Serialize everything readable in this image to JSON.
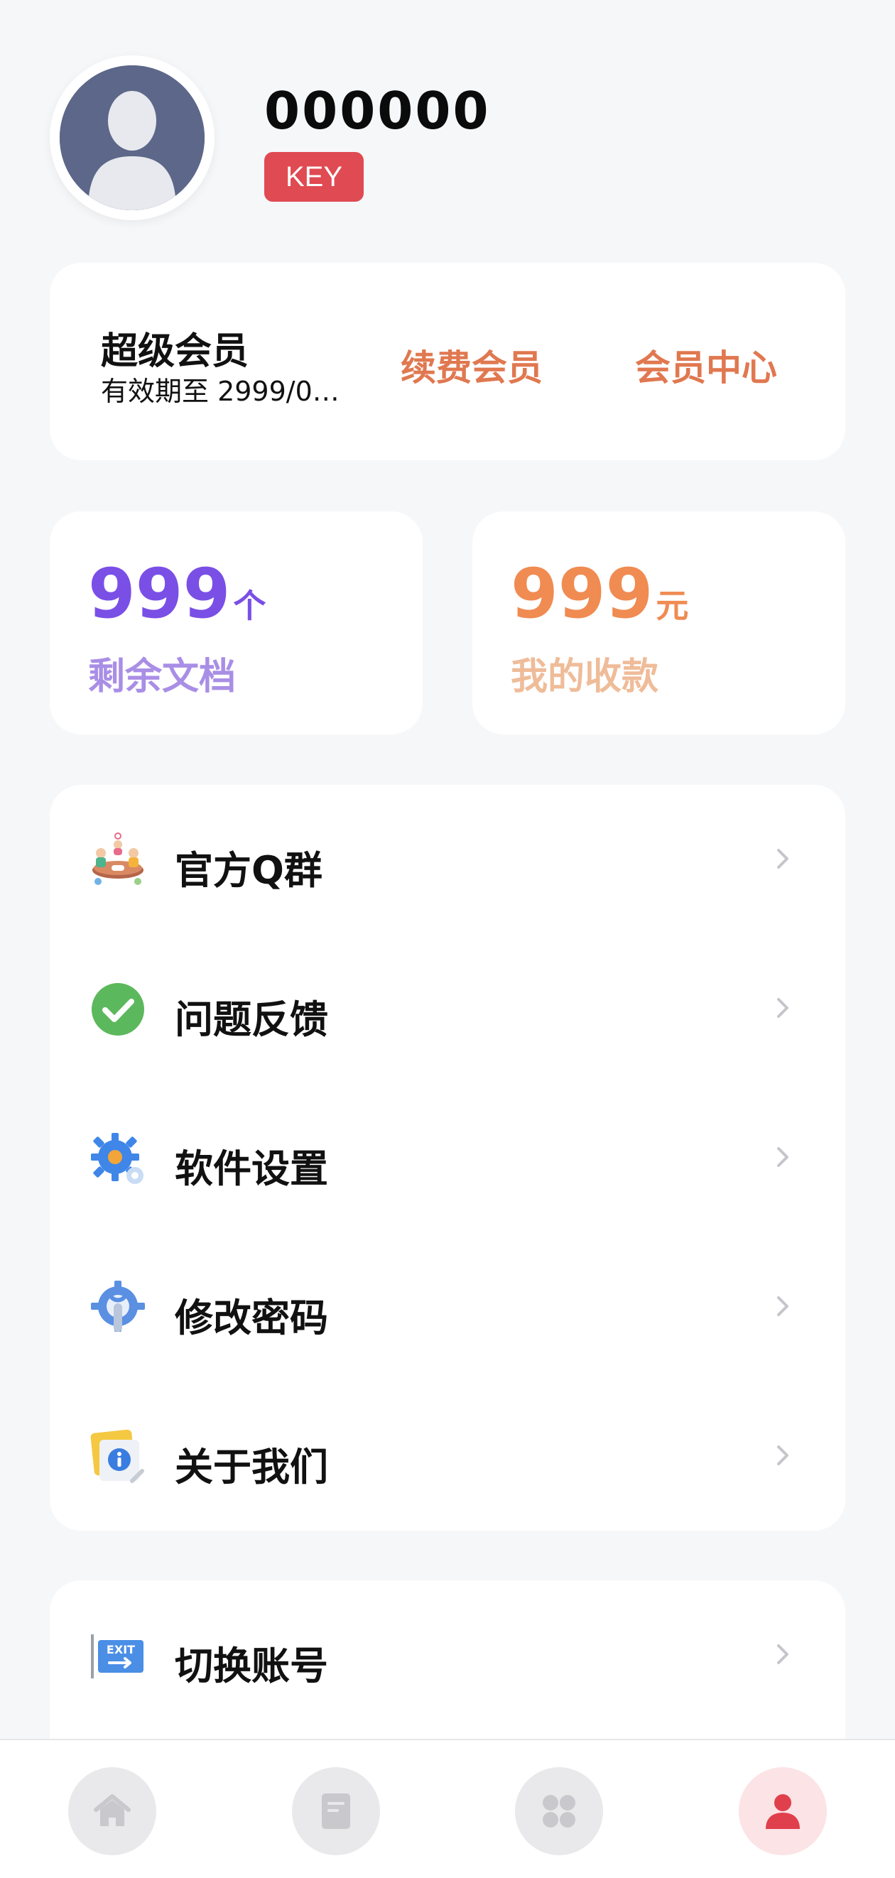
{
  "profile": {
    "username": "000000",
    "badge": "KEY",
    "avatar_icon": "user-silhouette-icon"
  },
  "vip": {
    "title": "超级会员",
    "expiry": "有效期至  2999/0…",
    "renew_label": "续费会员",
    "center_label": "会员中心"
  },
  "stats": {
    "docs": {
      "value": "999",
      "unit": "个",
      "label": "剩余文档"
    },
    "payments": {
      "value": "999",
      "unit": "元",
      "label": "我的收款"
    }
  },
  "menu": {
    "items": [
      {
        "label": "官方Q群",
        "icon": "group-chat-icon"
      },
      {
        "label": "问题反馈",
        "icon": "check-circle-icon"
      },
      {
        "label": "软件设置",
        "icon": "gear-icon"
      },
      {
        "label": "修改密码",
        "icon": "wrench-gear-icon"
      },
      {
        "label": "关于我们",
        "icon": "info-icon"
      }
    ],
    "switch_account": {
      "label": "切换账号",
      "icon": "exit-icon"
    }
  },
  "bottom_nav": {
    "items": [
      "home-icon",
      "document-icon",
      "apps-icon",
      "profile-icon"
    ],
    "active": "profile-icon",
    "active_color": "#e0404c"
  },
  "colors": {
    "badge": "#e04a52",
    "vip_links": "#e07850",
    "docs_accent": "#7a4fe6",
    "pay_accent": "#f08b52"
  }
}
